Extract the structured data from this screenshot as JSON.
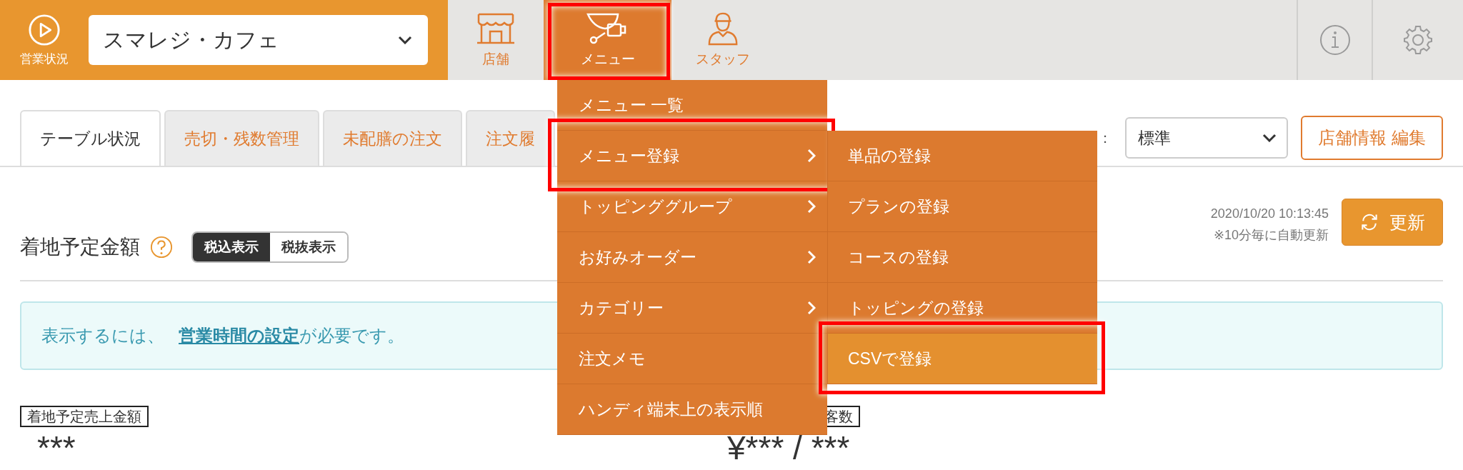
{
  "header": {
    "status_label": "営業状況",
    "store_select": {
      "value": "スマレジ・カフェ"
    },
    "nav": [
      {
        "label": "店舗",
        "selected": false,
        "annotated": false
      },
      {
        "label": "メニュー",
        "selected": true,
        "annotated": true
      },
      {
        "label": "スタッフ",
        "selected": false,
        "annotated": false
      }
    ]
  },
  "tabs": [
    {
      "label": "テーブル状況",
      "selected": true
    },
    {
      "label": "売切・残数管理",
      "selected": false
    },
    {
      "label": "未配膳の注文",
      "selected": false
    },
    {
      "label": "注文履",
      "selected": false
    }
  ],
  "business_hours": {
    "label": "：",
    "value": "標準"
  },
  "edit_button": "店舗情報 編集",
  "updated": {
    "timestamp": "2020/10/20 10:13:45",
    "note": "※10分毎に自動更新",
    "button": "更新"
  },
  "summary": {
    "title": "着地予定金額",
    "tax_toggle": [
      {
        "label": "税込表示",
        "selected": true
      },
      {
        "label": "税抜表示",
        "selected": false
      }
    ]
  },
  "notice": {
    "text": "表示するには、",
    "link": "営業時間の設定",
    "suffix": "が必要です。"
  },
  "metrics": [
    {
      "label": "着地予定売上金額",
      "value": "***"
    },
    {
      "label": "客数",
      "value": "¥*** / ***"
    }
  ],
  "menu": {
    "items": [
      {
        "label": "メニュー 一覧",
        "has_submenu": false,
        "annotated": false
      },
      {
        "label": "メニュー登録",
        "has_submenu": true,
        "annotated": true
      },
      {
        "label": "トッピンググループ",
        "has_submenu": true,
        "annotated": false
      },
      {
        "label": "お好みオーダー",
        "has_submenu": true,
        "annotated": false
      },
      {
        "label": "カテゴリー",
        "has_submenu": true,
        "annotated": false
      },
      {
        "label": "注文メモ",
        "has_submenu": false,
        "annotated": false
      },
      {
        "label": "ハンディ端末上の表示順",
        "has_submenu": false,
        "annotated": false
      }
    ],
    "submenu": [
      {
        "label": "単品の登録",
        "selected": false,
        "annotated": false
      },
      {
        "label": "プランの登録",
        "selected": false,
        "annotated": false
      },
      {
        "label": "コースの登録",
        "selected": false,
        "annotated": false
      },
      {
        "label": "トッピングの登録",
        "selected": false,
        "annotated": false
      },
      {
        "label": "CSVで登録",
        "selected": true,
        "annotated": true
      }
    ]
  }
}
